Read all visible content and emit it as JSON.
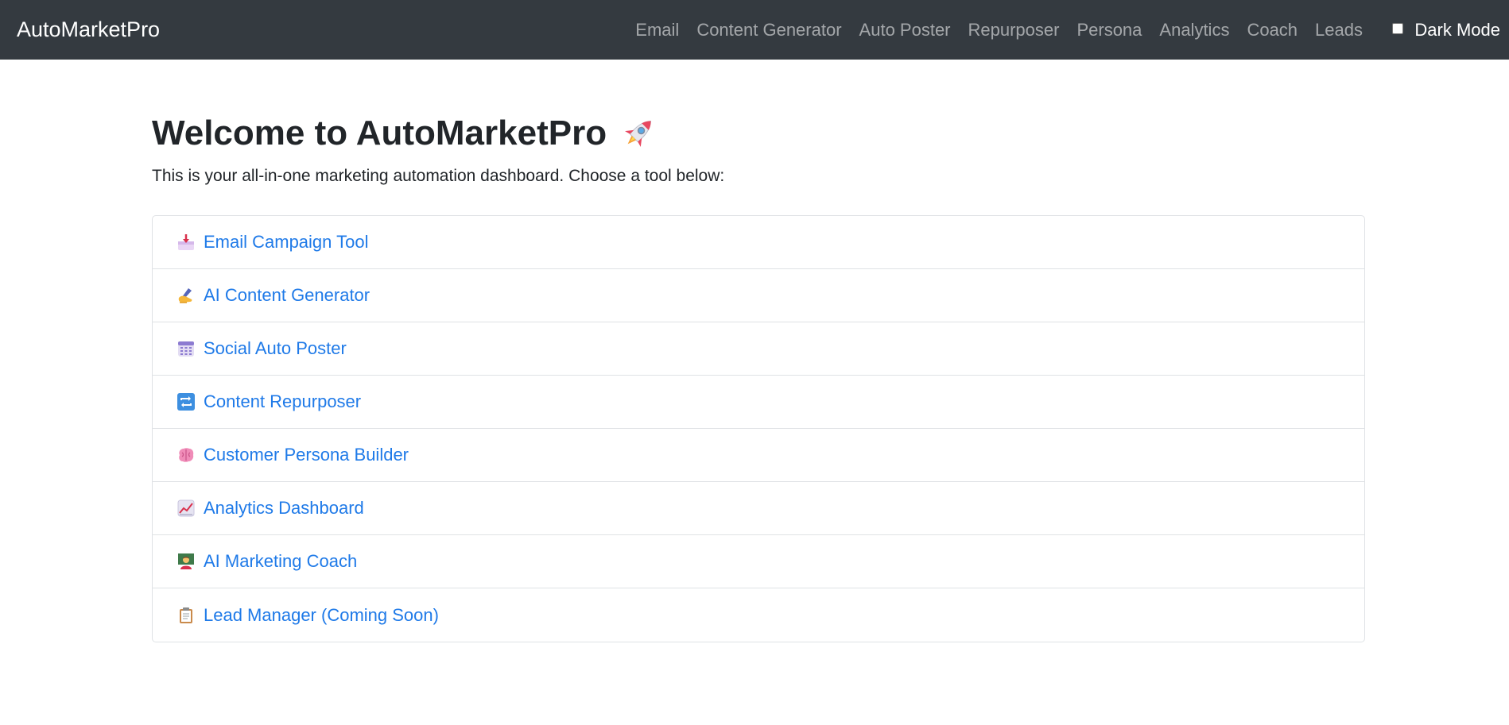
{
  "navbar": {
    "brand": "AutoMarketPro",
    "links": [
      {
        "label": "Email"
      },
      {
        "label": "Content Generator"
      },
      {
        "label": "Auto Poster"
      },
      {
        "label": "Repurposer"
      },
      {
        "label": "Persona"
      },
      {
        "label": "Analytics"
      },
      {
        "label": "Coach"
      },
      {
        "label": "Leads"
      }
    ],
    "dark_mode": {
      "label": "Dark Mode",
      "checked": false
    }
  },
  "main": {
    "title": "Welcome to AutoMarketPro",
    "title_icon": "rocket-icon",
    "subtitle": "This is your all-in-one marketing automation dashboard. Choose a tool below:"
  },
  "tools": [
    {
      "icon": "inbox-tray-icon",
      "label": "Email Campaign Tool"
    },
    {
      "icon": "writing-hand-icon",
      "label": "AI Content Generator"
    },
    {
      "icon": "calendar-icon",
      "label": "Social Auto Poster"
    },
    {
      "icon": "repeat-arrows-icon",
      "label": "Content Repurposer"
    },
    {
      "icon": "brain-icon",
      "label": "Customer Persona Builder"
    },
    {
      "icon": "chart-increasing-icon",
      "label": "Analytics Dashboard"
    },
    {
      "icon": "teacher-icon",
      "label": "AI Marketing Coach"
    },
    {
      "icon": "clipboard-icon",
      "label": "Lead Manager (Coming Soon)"
    }
  ],
  "colors": {
    "navbar_bg": "#343a40",
    "link": "#1f7ae8",
    "border": "#dfe2e5"
  }
}
